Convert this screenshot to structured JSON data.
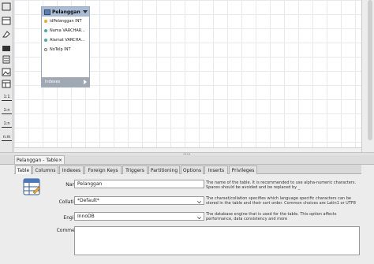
{
  "diagram": {
    "table": {
      "name": "Pelanggan",
      "columns": [
        {
          "label": "idPelanggan INT",
          "key": "pk"
        },
        {
          "label": "Nama VARCHAR...",
          "key": "nn"
        },
        {
          "label": "Alamat VARCHA...",
          "key": "nn"
        },
        {
          "label": "NoTelp INT",
          "key": "nul"
        }
      ],
      "footer": "Indexes"
    }
  },
  "relationship_tools": [
    "1:1",
    "1:n",
    "1:n",
    "n:m"
  ],
  "editor": {
    "tab_title": "Pelanggan - Table",
    "close_glyph": "×",
    "tabs": [
      "Table",
      "Columns",
      "Indexes",
      "Foreign Keys",
      "Triggers",
      "Partitioning",
      "Options",
      "Inserts",
      "Privileges"
    ],
    "active_tab": "Table",
    "form": {
      "name_label": "Name:",
      "name_value": "Pelanggan",
      "name_help": "The name of the table. It is recommended to use alpha-numeric characters. Spaces should be avoided and be replaced by _",
      "collation_label": "Collation:",
      "collation_value": "*Default*",
      "collation_help": "The charset/collation specifies which language specific characters can be stored in the table and their sort order. Common choices are Latin1 or UTF8",
      "engine_label": "Engine:",
      "engine_value": "InnoDB",
      "engine_help": "The database engine that is used for the table. This option affects performance, data consistency and more",
      "comment_label": "Comment:",
      "comment_value": ""
    }
  },
  "colors": {
    "table_header": "#a9bcd4",
    "table_footer": "#9fa8b3",
    "canvas_bg": "#ffffff"
  },
  "icons": [
    "pointer-icon",
    "hand-icon",
    "eraser-icon",
    "layer-icon",
    "note-icon",
    "image-icon",
    "table-icon",
    "table-editor-icon",
    "dropdown-arrow-icon"
  ]
}
